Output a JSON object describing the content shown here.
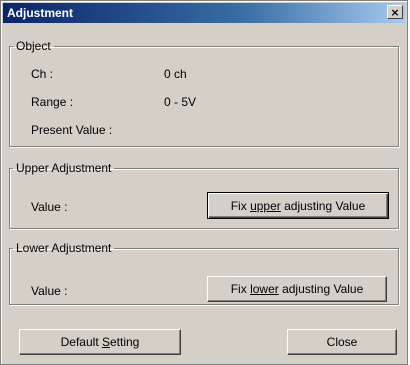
{
  "window": {
    "title": "Adjustment",
    "close_glyph": "×"
  },
  "object_group": {
    "legend": "Object",
    "ch_label": "Ch :",
    "ch_value": "0 ch",
    "range_label": "Range :",
    "range_value": "0 - 5V",
    "present_label": "Present Value :",
    "present_value": ""
  },
  "upper_group": {
    "legend": "Upper Adjustment",
    "value_label": "Value :",
    "button_pre": "Fix ",
    "button_mnemonic": "upper",
    "button_post": " adjusting Value"
  },
  "lower_group": {
    "legend": "Lower Adjustment",
    "value_label": "Value :",
    "button_pre": "Fix ",
    "button_mnemonic": "lower",
    "button_post": " adjusting Value"
  },
  "footer": {
    "default_pre": "Default ",
    "default_mnemonic": "S",
    "default_post": "etting",
    "close_label": "Close"
  }
}
